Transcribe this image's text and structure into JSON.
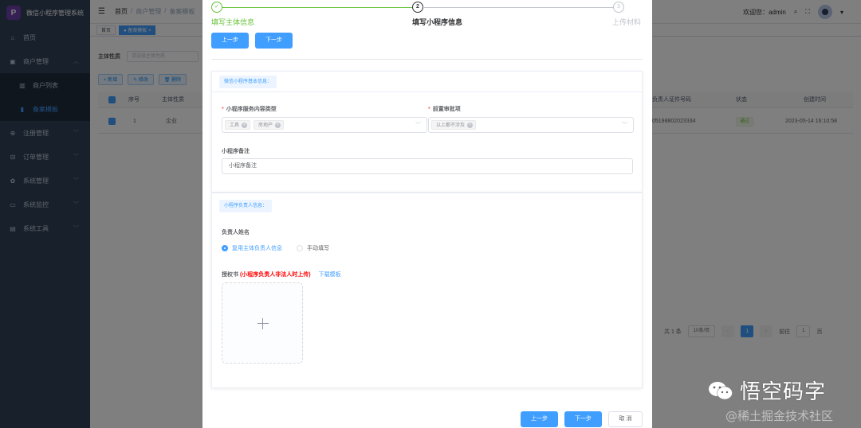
{
  "app": {
    "title": "微信小程序管理系统",
    "logo_glyph": "P"
  },
  "sidebar": {
    "items": [
      {
        "label": "首页",
        "icon": "home-icon",
        "glyph": "⌂"
      },
      {
        "label": "商户管理",
        "icon": "shop-icon",
        "glyph": "▣",
        "expanded": true
      },
      {
        "label": "注册管理",
        "icon": "register-icon",
        "glyph": "⊕"
      },
      {
        "label": "订单管理",
        "icon": "cart-icon",
        "glyph": "⊟"
      },
      {
        "label": "系统管理",
        "icon": "gear-icon",
        "glyph": "✿"
      },
      {
        "label": "系统监控",
        "icon": "monitor-icon",
        "glyph": "▭"
      },
      {
        "label": "系统工具",
        "icon": "tool-icon",
        "glyph": "▤"
      }
    ],
    "subitems": [
      {
        "label": "商户列表",
        "icon": "list-icon",
        "glyph": "▥"
      },
      {
        "label": "备案模板",
        "icon": "template-icon",
        "glyph": "▮",
        "active": true
      }
    ]
  },
  "navbar": {
    "breadcrumb": [
      "首页",
      "/",
      "商户管理",
      "/",
      "备案模板"
    ],
    "welcome": "欢迎您：admin"
  },
  "tagsview": {
    "tags": [
      "首页",
      "● 备案模板 ×"
    ]
  },
  "background": {
    "filter_label": "主体性质",
    "filter_placeholder": "请选择主体性质",
    "buttons": [
      "+ 新增",
      "✎ 修改",
      "🗑 删除"
    ],
    "headers": [
      "序号",
      "主体性质",
      "负责人证件号码",
      "状态",
      "创建时间"
    ],
    "row": {
      "index": "1",
      "type": "企业",
      "id_number": "05198802023334",
      "status": "通过",
      "created": "2023-05-14 16:10:58"
    },
    "pager": {
      "total": "共 1 条",
      "page_size": "10条/页",
      "prev": "‹",
      "page": "1",
      "next": "›",
      "goto": "前往",
      "goto_value": "1",
      "unit": "页"
    }
  },
  "dialog": {
    "steps": [
      {
        "title": "填写主体信息",
        "state": "done",
        "glyph": "✓"
      },
      {
        "title": "填写小程序信息",
        "state": "current",
        "glyph": "2"
      },
      {
        "title": "上传材料",
        "state": "wait",
        "glyph": "3"
      }
    ],
    "top_prev": "上一步",
    "top_next": "下一步",
    "section1": {
      "tag": "微信小程序基本信息：",
      "service_label": "小程序服务内容类型",
      "service_chips": [
        "工具",
        "房地产"
      ],
      "approval_label": "前置审批项",
      "approval_chips": [
        "以上都不涉及"
      ],
      "remark_label": "小程序备注",
      "remark_value": "小程序备注"
    },
    "section2": {
      "tag": "小程序负责人信息：",
      "name_label": "负责人姓名",
      "radio_reuse": "复用主体负责人信息",
      "radio_manual": "手动填写",
      "auth_label": "授权书",
      "auth_warn": "(小程序负责人非法人时上传)",
      "auth_link": "下载模板"
    },
    "footer": {
      "prev": "上一步",
      "next": "下一步",
      "cancel": "取 消"
    }
  },
  "watermark": {
    "title": "悟空码字",
    "source": "@稀土掘金技术社区"
  },
  "colors": {
    "primary": "#409eff",
    "success": "#67c23a",
    "danger": "#f56c6c",
    "sidebar": "#304156"
  }
}
